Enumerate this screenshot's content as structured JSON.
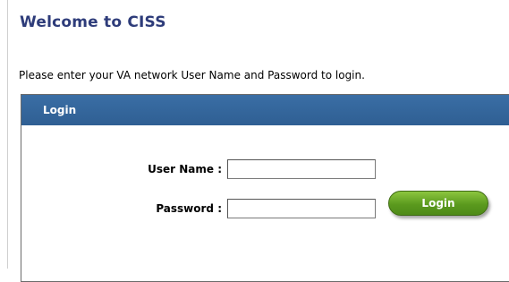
{
  "page": {
    "title": "Welcome to CISS",
    "instructions": "Please enter your VA network User Name and Password to login."
  },
  "login_panel": {
    "header": "Login",
    "username_label": "User Name :",
    "username_value": "",
    "password_label": "Password :",
    "password_value": "",
    "submit_label": "Login"
  },
  "colors": {
    "title": "#2e3c7a",
    "panel_header": "#336699",
    "button": "#5b9a1e"
  }
}
